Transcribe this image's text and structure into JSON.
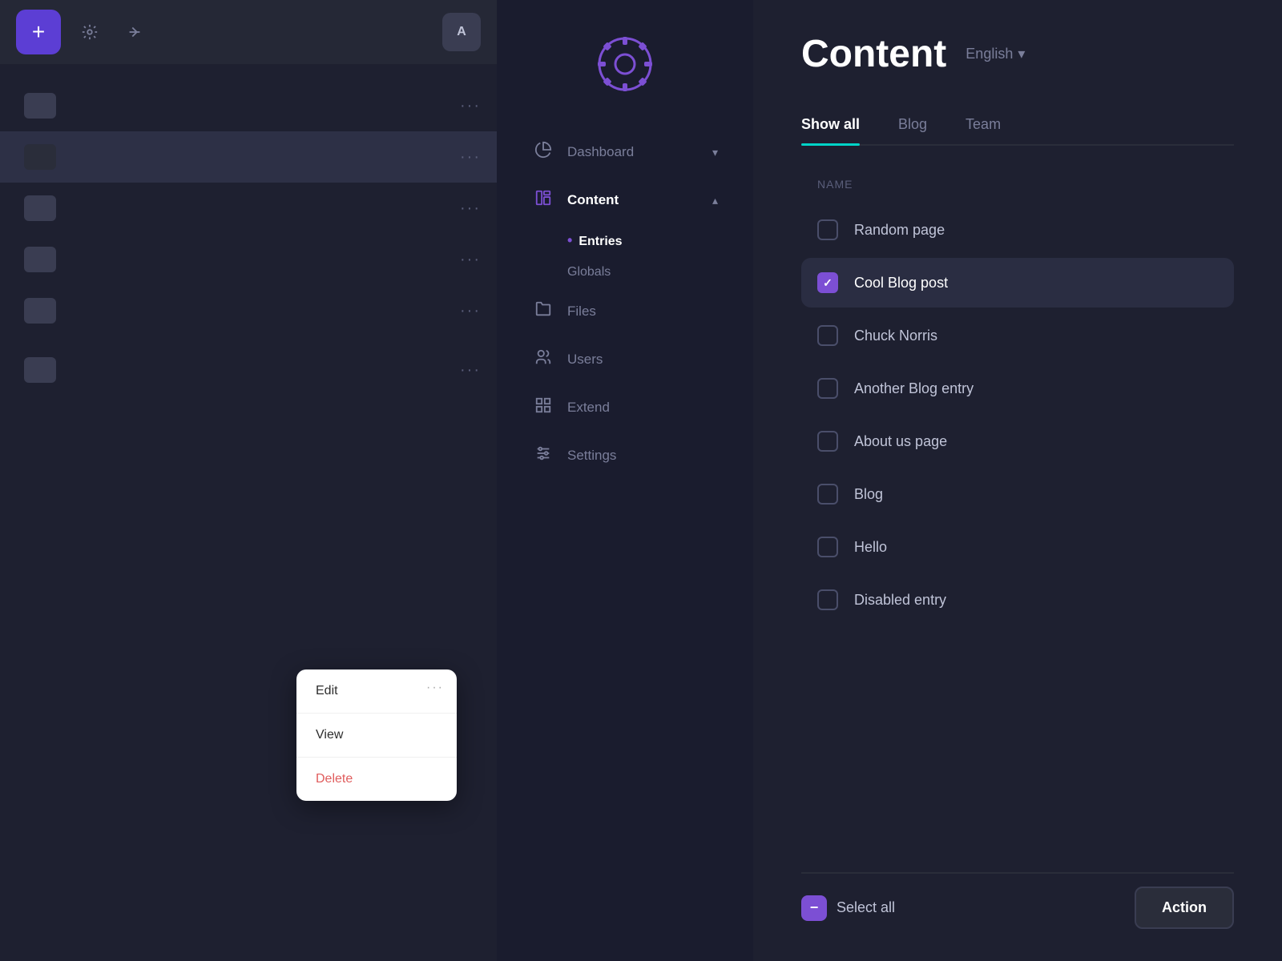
{
  "leftPanel": {
    "addLabel": "+",
    "avatarLabel": "A",
    "items": [
      {
        "id": 1,
        "highlighted": false
      },
      {
        "id": 2,
        "highlighted": true
      },
      {
        "id": 3,
        "highlighted": false
      },
      {
        "id": 4,
        "highlighted": false
      },
      {
        "id": 5,
        "highlighted": false
      }
    ],
    "contextMenu": {
      "dots": "···",
      "items": [
        {
          "label": "Edit",
          "type": "normal"
        },
        {
          "label": "View",
          "type": "normal"
        },
        {
          "label": "Delete",
          "type": "delete"
        }
      ]
    },
    "dotsLabel": "···"
  },
  "sidebar": {
    "navItems": [
      {
        "label": "Dashboard",
        "icon": "chart",
        "hasArrow": true,
        "active": false
      },
      {
        "label": "Content",
        "icon": "content",
        "hasArrow": true,
        "active": true
      },
      {
        "label": "Files",
        "icon": "files",
        "hasArrow": false,
        "active": false
      },
      {
        "label": "Users",
        "icon": "users",
        "hasArrow": false,
        "active": false
      },
      {
        "label": "Extend",
        "icon": "extend",
        "hasArrow": false,
        "active": false
      },
      {
        "label": "Settings",
        "icon": "settings",
        "hasArrow": false,
        "active": false
      }
    ],
    "subItems": [
      {
        "label": "Entries",
        "active": true
      },
      {
        "label": "Globals",
        "active": false
      }
    ]
  },
  "main": {
    "title": "Content",
    "language": "English",
    "languageArrow": "▾",
    "tabs": [
      {
        "label": "Show all",
        "active": true
      },
      {
        "label": "Blog",
        "active": false
      },
      {
        "label": "Team",
        "active": false
      }
    ],
    "tableHeader": "Name",
    "entries": [
      {
        "name": "Random page",
        "checked": false,
        "selected": false
      },
      {
        "name": "Cool Blog post",
        "checked": true,
        "selected": true
      },
      {
        "name": "Chuck Norris",
        "checked": false,
        "selected": false
      },
      {
        "name": "Another Blog entry",
        "checked": false,
        "selected": false
      },
      {
        "name": "About us page",
        "checked": false,
        "selected": false
      },
      {
        "name": "Blog",
        "checked": false,
        "selected": false
      },
      {
        "name": "Hello",
        "checked": false,
        "selected": false
      },
      {
        "name": "Disabled entry",
        "checked": false,
        "selected": false
      }
    ],
    "bottomBar": {
      "selectAllLabel": "Select all",
      "actionLabel": "Action"
    }
  }
}
